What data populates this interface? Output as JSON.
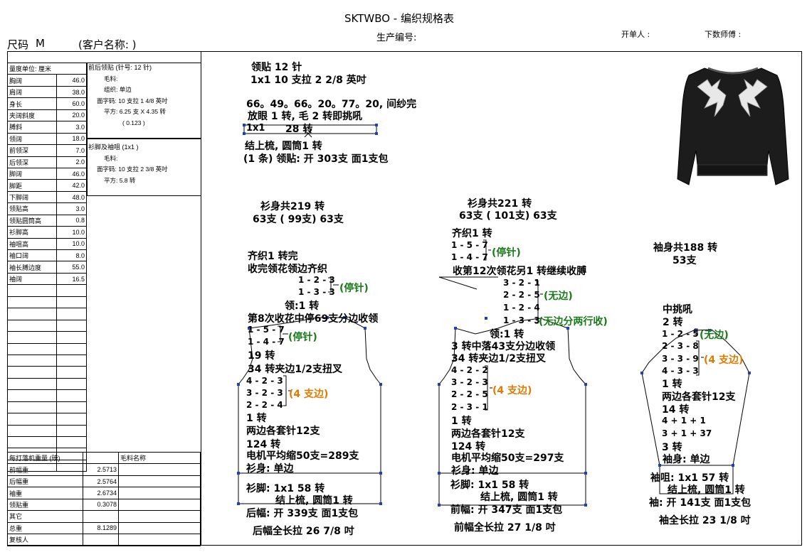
{
  "header": {
    "title": "SKTWBO - 编织规格表",
    "production_no_label": "生产编号:",
    "issuer_label": "开单人 :",
    "technician_label": "下数师傅 :",
    "size_label": "尺码",
    "size_value": "M",
    "customer_label": "(客户名称: )"
  },
  "measure": {
    "unit_header": "量度单位: 厘米",
    "rows": [
      {
        "name": "胸阔",
        "value": "46.0"
      },
      {
        "name": "肩阔",
        "value": "38.0"
      },
      {
        "name": "身长",
        "value": "60.0"
      },
      {
        "name": "夹阔斜度",
        "value": "20.0"
      },
      {
        "name": "膊斜",
        "value": "3.0"
      },
      {
        "name": "领阔",
        "value": "18.0"
      },
      {
        "name": "前领深",
        "value": "7.0"
      },
      {
        "name": "后领深",
        "value": "2.0"
      },
      {
        "name": "脚阔",
        "value": "46.0"
      },
      {
        "name": "脚距",
        "value": "42.0"
      },
      {
        "name": "下脚阔",
        "value": "48.0"
      },
      {
        "name": "领贴高",
        "value": "3.0"
      },
      {
        "name": "领贴圆筒高",
        "value": "0.8"
      },
      {
        "name": "衫脚高",
        "value": "10.0"
      },
      {
        "name": "袖咀高",
        "value": "10.0"
      },
      {
        "name": "袖口阔",
        "value": "8.0"
      },
      {
        "name": "袖长膊边度",
        "value": "55.0"
      },
      {
        "name": "袖阔",
        "value": "16.5"
      }
    ]
  },
  "notes": {
    "front_rib_title": "前后领贴 (针号: 12 针)",
    "front_rib_yarn": "毛料:",
    "front_rib_weave": "组织: 单边",
    "front_rib_density": "面字码: 10 支拉 1 4/8 英吋",
    "front_rib_square": "平方: 6.25 支 X 4.35 转",
    "front_rib_ratio": "( 0.123 )",
    "hem_title": "衫脚及袖咀 (1x1 )",
    "hem_yarn": "毛料:",
    "hem_density": "面字码: 10 支拉 2 3/8 英吋",
    "hem_square": "平方: 5.8 转"
  },
  "weights": {
    "header": "每打落机重量 (磅)",
    "yarn_header": "毛料名称",
    "rows": [
      {
        "name": "前幅重",
        "value": "2.5713"
      },
      {
        "name": "后幅重",
        "value": "2.5764"
      },
      {
        "name": "袖重",
        "value": "2.6734"
      },
      {
        "name": "领贴重",
        "value": "0.3078"
      },
      {
        "name": "其它",
        "value": ""
      },
      {
        "name": "总重",
        "value": "8.1289"
      },
      {
        "name": "复核人",
        "value": ""
      }
    ]
  },
  "collar": {
    "title": "领贴 12 针",
    "line1": "1x1   10 支拉 2 2/8 英吋",
    "line2": "66。49。66。20。77。20, 间纱完",
    "line3": "放眼 1 转, 毛 2 转即挑吼",
    "rib": "1x1",
    "rib_rows": "28 转",
    "line4": "结上梳, 圆筒1 转",
    "line5": "(1 条) 领贴: 开 303支  面1支包"
  },
  "back": {
    "body_total": "衫身共219 转",
    "needles": "63支 ( 99支) 63支",
    "neck1": "齐织1 转完",
    "neck2": "收完领花领边齐织",
    "dec_a1": "1 - 2 - 3",
    "dec_a2": "1 - 3 - 3",
    "stop_a": "(停针)",
    "neck3": "领:1 转",
    "neck4": "第8次收花中停69支分边收领",
    "dec_b1": "1 - 5 - 7",
    "dec_b2": "1 - 4 - 7",
    "stop_b": "(停针)",
    "rows19": "19 转",
    "twist": "34 转夹边1/2支扭叉",
    "dec_c1": "4 - 2 - 3",
    "dec_c2": "3 - 2 - 3",
    "dec_c3": "2 - 2 - 4",
    "four_edge": "(4 支边)",
    "one_row": "1 转",
    "sets": "两边各套针12支",
    "rows124": "124 转",
    "machine": "电机平均缩50支=289支",
    "body_knit": "衫身: 单边",
    "hem": "衫脚: 1x1     58 转",
    "hem2": "结上梳, 圆筒1 转",
    "open": "后幅: 开 339支  面1支包",
    "length": "后幅全长拉 26 7/8 吋"
  },
  "front": {
    "body_total": "衫身共221 转",
    "needles": "63支 ( 101支) 63支",
    "neck1": "齐织1 转",
    "dec_a1": "1 - 5 - 7",
    "dec_a2": "1 - 4 - 7",
    "stop_a": "(停针)",
    "neck2": "收第12次领花另1 转继续收膊",
    "dec_b1": "3 - 2 - 1",
    "dec_b2": "2 - 2 - 5",
    "dec_b3": "1 - 2 - 4",
    "dec_b4": "1 - 3 - 3",
    "no_edge": "(无边)",
    "no_edge2": "(无边分两行收)",
    "neck3": "领:1 转",
    "neck4": "3 转中落43支分边收领",
    "twist": "34 转夹边1/2支扭叉",
    "dec_c1": "4 - 2 - 2",
    "dec_c2": "3 - 2 - 3",
    "dec_c3": "2 - 2 - 5",
    "dec_c4": "2 - 3 - 1",
    "four_edge": "(4 支边)",
    "one_row": "1 转",
    "sets": "两边各套针12支",
    "rows124": "124 转",
    "machine": "电机平均缩50支=297支",
    "body_knit": "衫身: 单边",
    "hem": "衫脚: 1x1     58 转",
    "hem2": "结上梳, 圆筒1 转",
    "open": "前幅: 开 347支  面1支包",
    "length": "前幅全长拉 27 1/8 吋"
  },
  "sleeve": {
    "body_total": "袖身共188 转",
    "needles": "53支",
    "mid": "中挑吼",
    "rows2": "2 转",
    "dec1": "1 - 2 - 5",
    "no_edge": "(无边)",
    "dec2": "2 - 3 - 8",
    "dec3": "3 - 3 - 9",
    "dec4": "4 - 3 - 3",
    "four_edge": "(4 支边)",
    "one_row": "1 转",
    "sets": "两边各套针12支",
    "rows14": "14 转",
    "inc1": "4 + 1 + 1",
    "inc2": "3 + 1 + 37",
    "rows3": "3 转",
    "body_knit": "袖身: 单边",
    "cuff": "袖咀: 1x1     57 转",
    "cuff2": "结上梳, 圆筒1 转",
    "open": "袖: 开 141支  面1支包",
    "length": "袖全长拉 23 1/8 吋"
  },
  "colors": {
    "green": "#1a7a1a",
    "orange": "#e07b00",
    "marker": "#1f3fbf"
  }
}
